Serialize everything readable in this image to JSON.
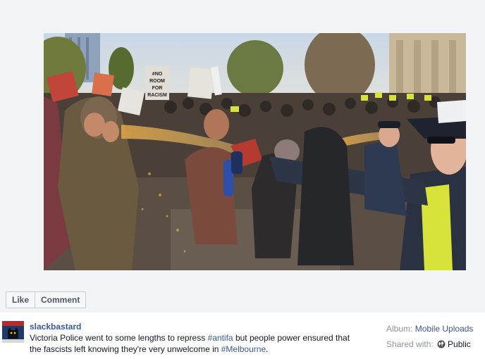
{
  "photo": {
    "signs": [
      "#NO",
      "ROOM",
      "FOR",
      "RACISM"
    ]
  },
  "actions": {
    "like_label": "Like",
    "comment_label": "Comment"
  },
  "post": {
    "author": "slackbastard",
    "text_1": "Victoria Police went to some lengths to repress ",
    "hashtag_1": "#antifa",
    "text_2": " but people power ensured that the fascists left knowing they're very unwelcome in ",
    "hashtag_2": "#Melbourne",
    "text_3": "."
  },
  "meta": {
    "album_label": "Album:",
    "album_name": "Mobile Uploads",
    "shared_label": "Shared with:",
    "globe_icon": "globe-icon",
    "privacy": "Public"
  },
  "colors": {
    "link": "#3b5998",
    "text": "#141823",
    "muted": "#90949c",
    "spray": "#e3a84a",
    "hi_vis": "#d7e23a"
  }
}
